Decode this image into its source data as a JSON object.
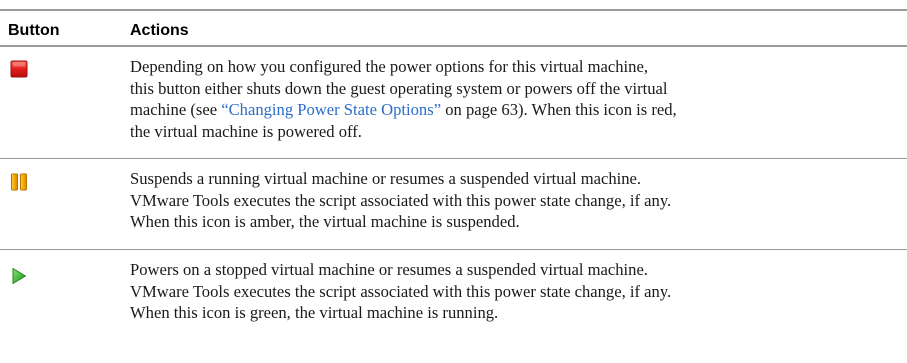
{
  "header": {
    "button_label": "Button",
    "actions_label": "Actions"
  },
  "rows": [
    {
      "icon": "stop-icon",
      "icon_color": "#e02020",
      "lines": [
        "Depending on how you configured the power options for this virtual machine,",
        "this button either shuts down the guest operating system or powers off the virtual",
        "machine (see ",
        "“Changing Power State Options”",
        " on page 63). When this icon is red,",
        "the virtual machine is powered off."
      ]
    },
    {
      "icon": "pause-icon",
      "icon_color": "#f0a400",
      "lines": [
        "Suspends a running virtual machine or resumes a suspended virtual machine.",
        "VMware Tools executes the script associated with this power state change, if any.",
        "When this icon is amber, the virtual machine is suspended."
      ]
    },
    {
      "icon": "play-icon",
      "icon_color": "#39b54a",
      "lines": [
        "Powers on a stopped virtual machine or resumes a suspended virtual machine.",
        "VMware Tools executes the script associated with this power state change, if any.",
        "When this icon is green, the virtual machine is running."
      ]
    }
  ]
}
